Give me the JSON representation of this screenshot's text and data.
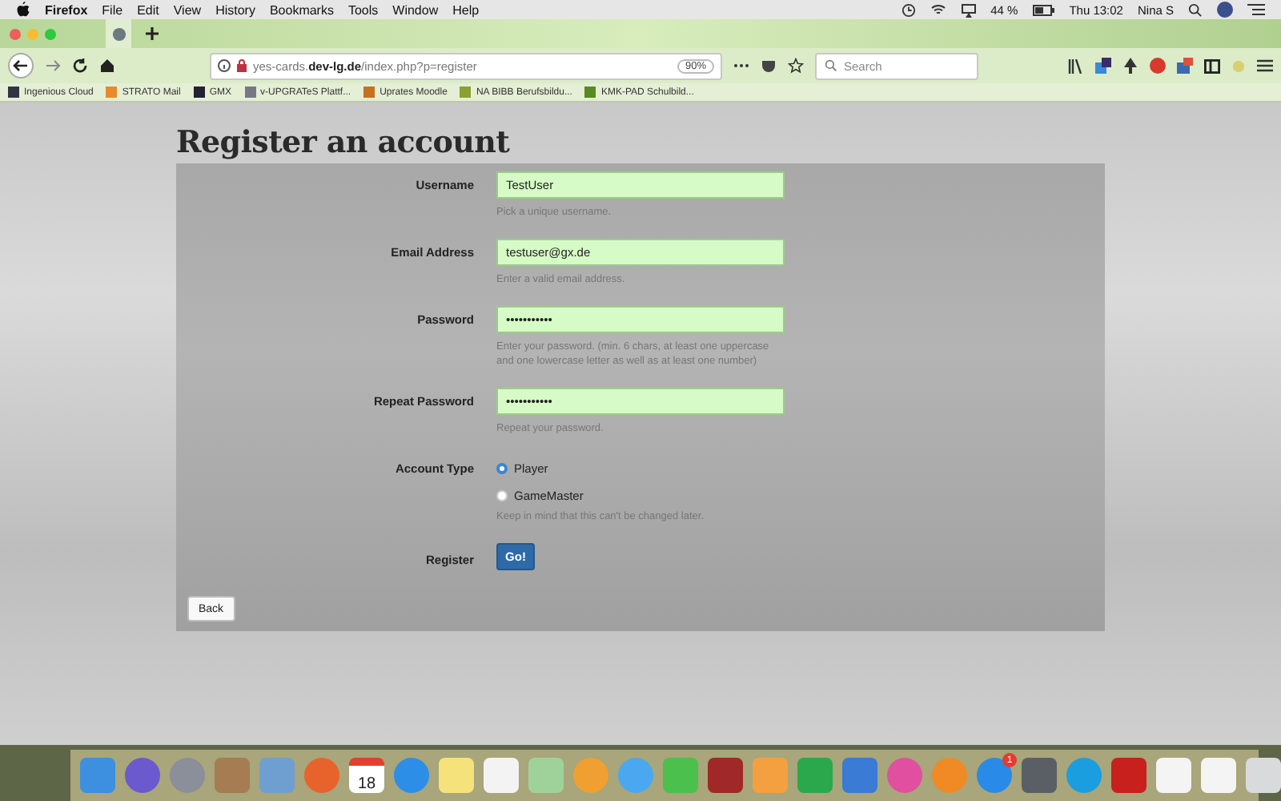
{
  "menu_bar": {
    "app": "Firefox",
    "menus": [
      "File",
      "Edit",
      "View",
      "History",
      "Bookmarks",
      "Tools",
      "Window",
      "Help"
    ],
    "battery": "44 %",
    "clock": "Thu 13:02",
    "user": "Nina S"
  },
  "toolbar": {
    "url_host_prefix": "yes-cards.",
    "url_host": "dev-lg.de",
    "url_path": "/index.php?p=register",
    "zoom": "90%",
    "search": {
      "placeholder": "Search"
    }
  },
  "bookmarks": [
    "Ingenious Cloud",
    "STRATO Mail",
    "GMX",
    "v-UPGRATeS Plattf...",
    "Uprates Moodle",
    "NA BIBB Berufsbildu...",
    "KMK-PAD Schulbild..."
  ],
  "page": {
    "title": "Register an account",
    "fields": [
      {
        "label": "Username",
        "value": "TestUser",
        "hint": "Pick a unique username."
      },
      {
        "label": "Email Address",
        "value": "testuser@gx.de",
        "hint": "Enter a valid email address."
      },
      {
        "label": "Password",
        "value": "•••••••••••",
        "hint": "Enter your password. (min. 6 chars, at least one uppercase and one lowercase letter as well as at least one number)"
      },
      {
        "label": "Repeat Password",
        "value": "•••••••••••",
        "hint": "Repeat your password."
      }
    ],
    "account_type": {
      "label": "Account Type",
      "options": [
        {
          "label": "Player",
          "selected": true
        },
        {
          "label": "GameMaster",
          "selected": false
        }
      ],
      "hint": "Keep in mind that this can't be changed later."
    },
    "register": {
      "label": "Register",
      "button": "Go!"
    },
    "back_button": "Back"
  },
  "dock": {
    "calendar_day": "18",
    "app_store_badge": "1"
  }
}
